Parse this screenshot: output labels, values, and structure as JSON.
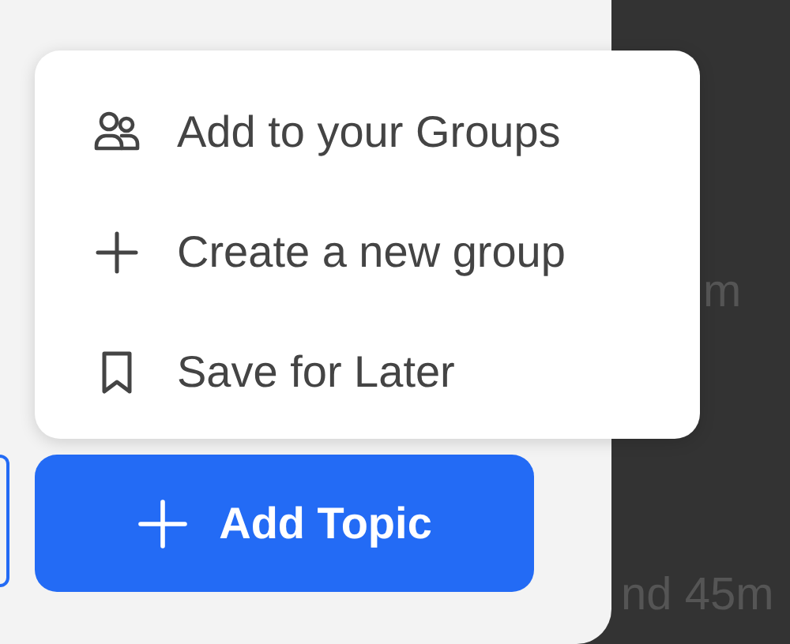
{
  "menu": {
    "items": [
      {
        "kind": "groups",
        "label": "Add to your Groups"
      },
      {
        "kind": "plus",
        "label": "Create a new group"
      },
      {
        "kind": "bookmark",
        "label": "Save for Later"
      }
    ]
  },
  "add_topic_button": {
    "label": "Add Topic"
  },
  "background": {
    "texts": [
      "m",
      "nd 45m"
    ]
  }
}
